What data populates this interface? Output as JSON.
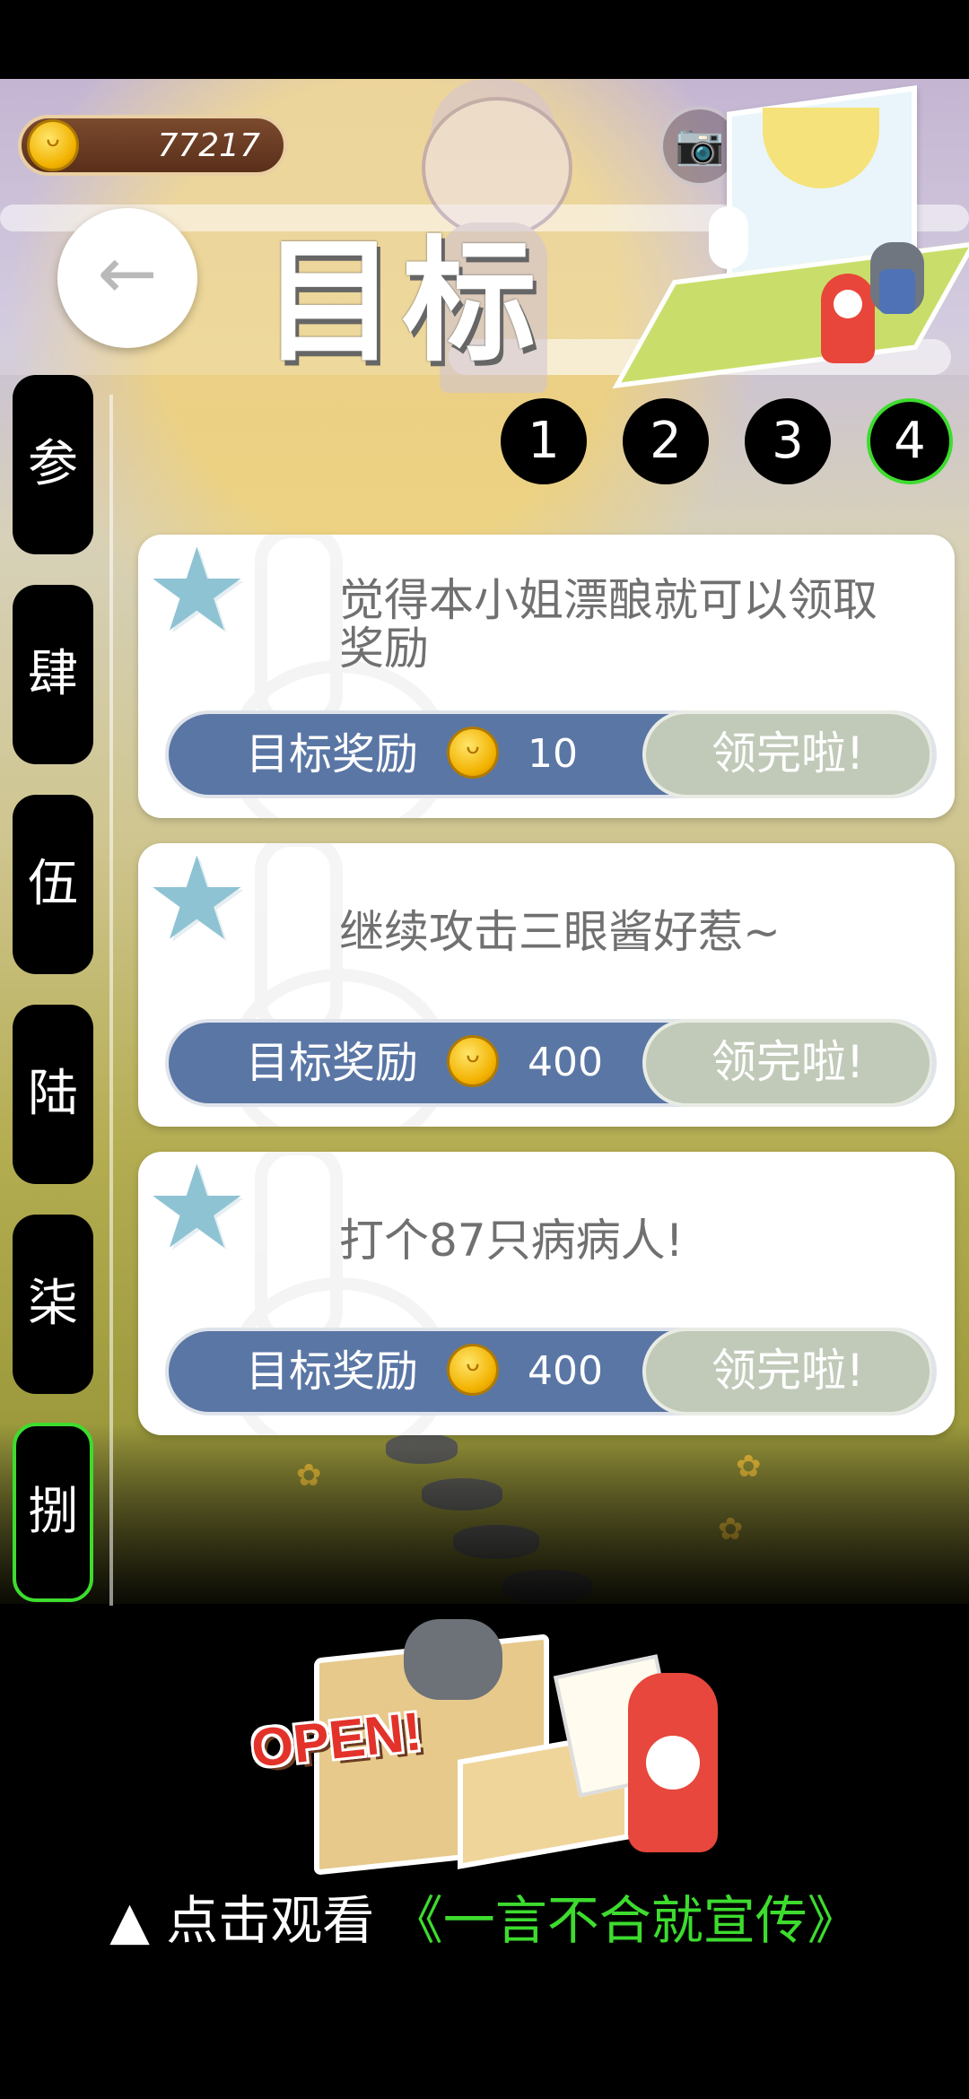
{
  "header": {
    "coin_amount": "77217",
    "title": "目标",
    "back_icon": "←",
    "camera_icon": "📷"
  },
  "side_tabs": [
    {
      "label": "参",
      "active": false
    },
    {
      "label": "肆",
      "active": false
    },
    {
      "label": "伍",
      "active": false
    },
    {
      "label": "陆",
      "active": false
    },
    {
      "label": "柒",
      "active": false
    },
    {
      "label": "捌",
      "active": true
    }
  ],
  "pages": [
    {
      "label": "1",
      "active": false
    },
    {
      "label": "2",
      "active": false
    },
    {
      "label": "3",
      "active": false
    },
    {
      "label": "4",
      "active": true
    }
  ],
  "goals": [
    {
      "text": "觉得本小姐漂酿就可以领取奖励",
      "reward_label": "目标奖励",
      "reward_amount": "10",
      "button": "领完啦!"
    },
    {
      "text": "继续攻击三眼酱好惹~",
      "reward_label": "目标奖励",
      "reward_amount": "400",
      "button": "领完啦!"
    },
    {
      "text": "打个87只病病人!",
      "reward_label": "目标奖励",
      "reward_amount": "400",
      "button": "领完啦!"
    }
  ],
  "ad": {
    "open_text": "OPEN!",
    "prefix": "▲ 点击观看",
    "link": "《一言不合就宣传》"
  },
  "colors": {
    "accent_green": "#3ddc2e",
    "reward_blue": "#5a76a5",
    "claimed_gray": "#c1cab9",
    "star_blue": "#8ec3d3"
  }
}
